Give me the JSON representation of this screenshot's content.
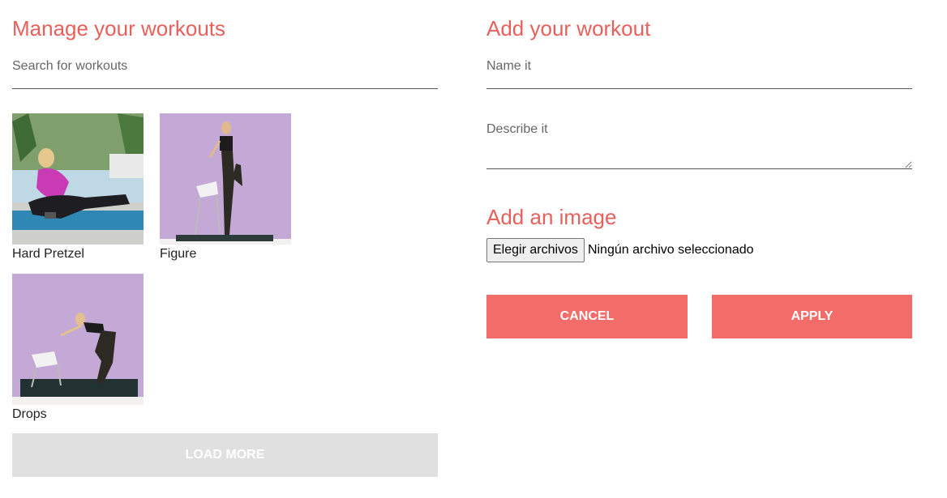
{
  "manage": {
    "title": "Manage your workouts",
    "search_placeholder": "Search for workouts",
    "workouts": [
      {
        "label": "Hard Pretzel"
      },
      {
        "label": "Figure"
      },
      {
        "label": "Drops"
      }
    ],
    "load_more_label": "LOAD MORE"
  },
  "add": {
    "title": "Add your workout",
    "name_placeholder": "Name it",
    "describe_placeholder": "Describe it",
    "image_title": "Add an image",
    "file_button_label": "Elegir archivos",
    "file_status": "Ningún archivo seleccionado",
    "cancel_label": "CANCEL",
    "apply_label": "APPLY"
  },
  "colors": {
    "accent": "#e8605c",
    "button": "#f26d6a",
    "load_more_bg": "#e0e0e0"
  }
}
